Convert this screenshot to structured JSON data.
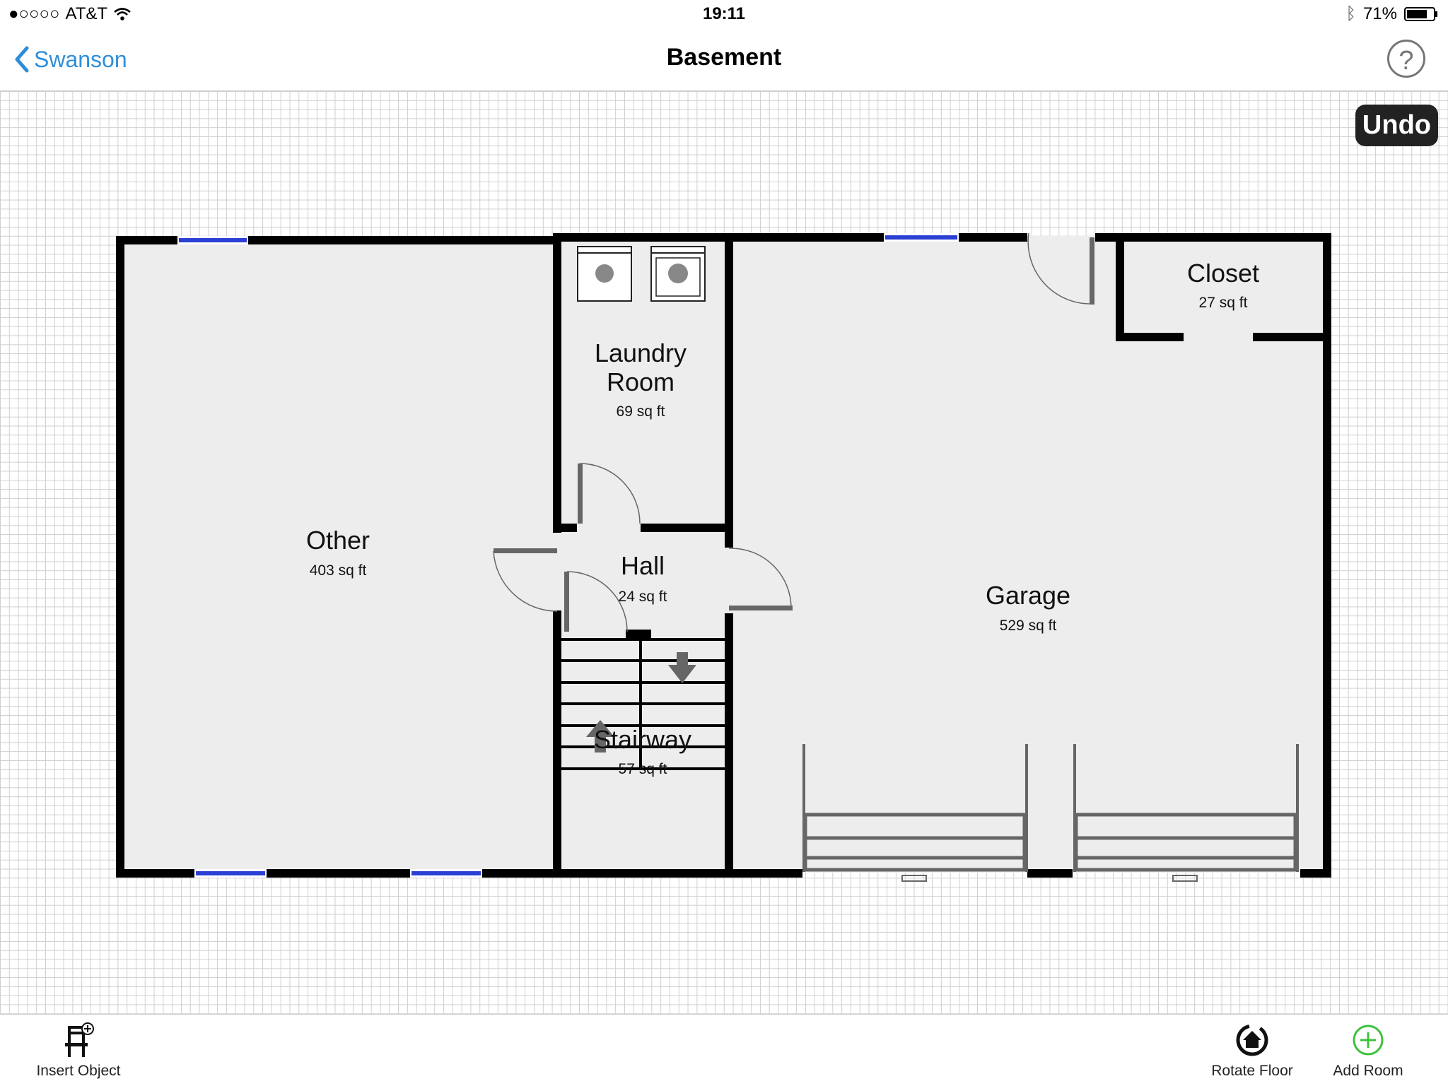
{
  "status_bar": {
    "carrier": "AT&T",
    "time": "19:11",
    "battery": "71%"
  },
  "nav": {
    "back_label": "Swanson",
    "title": "Basement",
    "help_icon": "help-icon"
  },
  "undo_label": "Undo",
  "rooms": {
    "other": {
      "name": "Other",
      "area": "403 sq ft"
    },
    "laundry": {
      "name_line1": "Laundry",
      "name_line2": "Room",
      "area": "69 sq ft"
    },
    "hall": {
      "name": "Hall",
      "area": "24 sq ft"
    },
    "stairway": {
      "name": "Stairway",
      "area": "57 sq ft"
    },
    "garage": {
      "name": "Garage",
      "area": "529 sq ft"
    },
    "closet": {
      "name": "Closet",
      "area": "27 sq ft"
    }
  },
  "toolbar": {
    "insert_object": "Insert Object",
    "rotate_floor": "Rotate Floor",
    "add_room": "Add Room"
  },
  "colors": {
    "accent": "#2f8ed9",
    "wall": "#000000",
    "floor": "#ededed",
    "add_green": "#3cc23c"
  }
}
